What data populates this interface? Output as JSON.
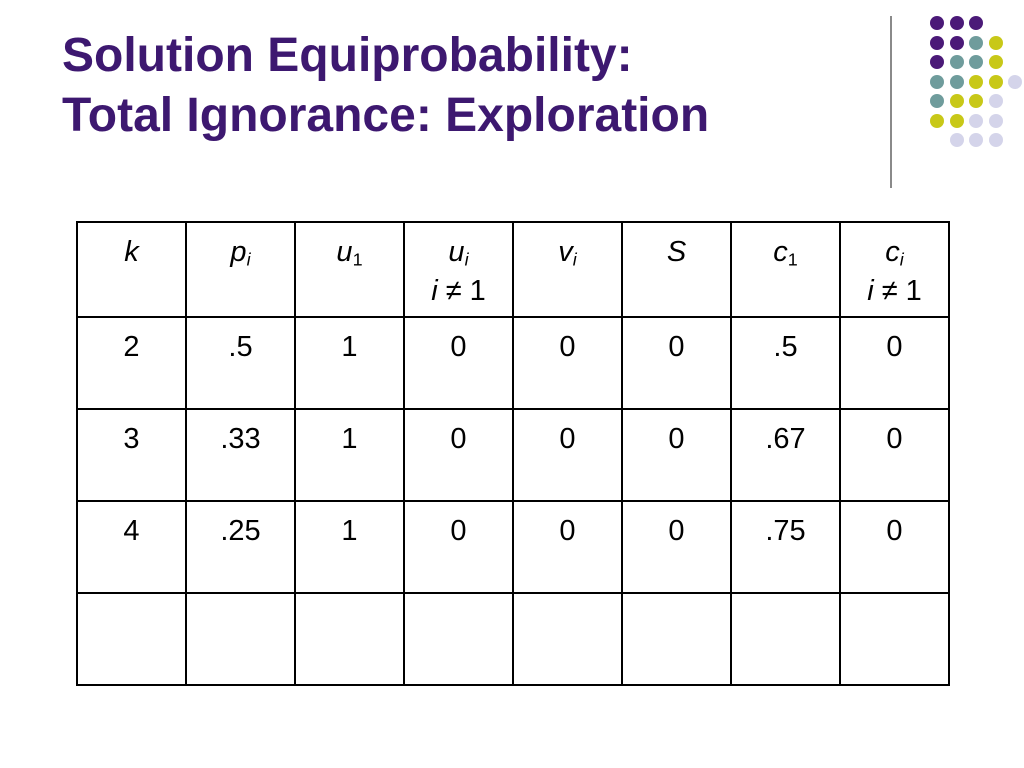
{
  "title": {
    "line1": "Solution Equiprobability:",
    "line2": "Total Ignorance: Exploration"
  },
  "colors": {
    "title": "#3d1870",
    "dot_purple": "#4b1a78",
    "dot_teal": "#6f9c9c",
    "dot_yellow": "#c8c818",
    "dot_lavender": "#d4d4ea",
    "divider": "#8a8a8a"
  },
  "headers": [
    {
      "main": "k",
      "sub": "",
      "extra": ""
    },
    {
      "main": "p",
      "sub": "i",
      "extra": ""
    },
    {
      "main": "u",
      "sub": "1",
      "extra": ""
    },
    {
      "main": "u",
      "sub": "i",
      "extra": "i ≠ 1"
    },
    {
      "main": "v",
      "sub": "i",
      "extra": ""
    },
    {
      "main": "S",
      "sub": "",
      "extra": ""
    },
    {
      "main": "c",
      "sub": "1",
      "extra": ""
    },
    {
      "main": "c",
      "sub": "i",
      "extra": "i ≠ 1"
    }
  ],
  "rows": [
    [
      "2",
      ".5",
      "1",
      "0",
      "0",
      "0",
      ".5",
      "0"
    ],
    [
      "3",
      ".33",
      "1",
      "0",
      "0",
      "0",
      ".67",
      "0"
    ],
    [
      "4",
      ".25",
      "1",
      "0",
      "0",
      "0",
      ".75",
      "0"
    ],
    [
      "",
      "",
      "",
      "",
      "",
      "",
      "",
      ""
    ]
  ],
  "decoration": {
    "dot_grid": [
      [
        "purple",
        "purple",
        "purple",
        "",
        ""
      ],
      [
        "purple",
        "purple",
        "teal",
        "yellow",
        ""
      ],
      [
        "purple",
        "teal",
        "teal",
        "yellow",
        ""
      ],
      [
        "teal",
        "teal",
        "yellow",
        "yellow",
        "lavender"
      ],
      [
        "teal",
        "yellow",
        "yellow",
        "lavender",
        ""
      ],
      [
        "yellow",
        "yellow",
        "lavender",
        "lavender",
        ""
      ],
      [
        "",
        "lavender",
        "lavender",
        "lavender",
        ""
      ]
    ]
  }
}
